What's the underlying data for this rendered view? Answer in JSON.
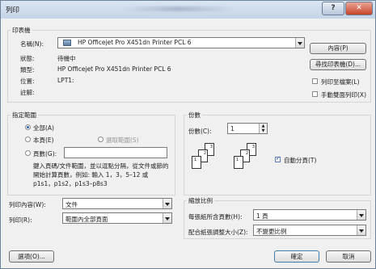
{
  "window": {
    "title": "列印",
    "help": "?",
    "close": "✕"
  },
  "printer": {
    "section_label": "印表機",
    "name_label": "名稱(N):",
    "name_value": "HP Officejet Pro X451dn Printer PCL 6",
    "status_label": "狀態:",
    "status_value": "待機中",
    "type_label": "類型:",
    "type_value": "HP Officejet Pro X451dn Printer PCL 6",
    "where_label": "位置:",
    "where_value": "LPT1:",
    "comment_label": "註解:",
    "properties_button": "內容(P)",
    "find_button": "尋找印表機(D)...",
    "print_to_file": "列印至檔案(L)",
    "manual_duplex": "手動雙面列印(X)"
  },
  "page_range": {
    "label": "指定範圍",
    "all": "全部(A)",
    "current": "本頁(E)",
    "selection": "選取範圍(S)",
    "pages": "頁數(G):",
    "pages_value": "",
    "hint": "鍵入頁碼/文件範圍，並以逗點分隔，從文件或節的開始計算頁數，例如: 輸入 1，3，5–12 或 p1s1，p1s2，p1s3–p8s3"
  },
  "copies": {
    "label": "份數",
    "count_label": "份數(C):",
    "count_value": "1",
    "collate": "自動分頁(T)",
    "collate_checked": true,
    "page_numbers": [
      "1",
      "2",
      "3",
      "1",
      "2",
      "3"
    ]
  },
  "print_what": {
    "label": "列印內容(W):",
    "value": "文件"
  },
  "print": {
    "label": "列印(R):",
    "value": "範圍內全部頁面"
  },
  "zoom": {
    "label": "縮放比例",
    "pages_per_sheet_label": "每張紙所含頁數(H):",
    "pages_per_sheet_value": "1 頁",
    "scale_label": "配合紙張調整大小(Z):",
    "scale_value": "不變更比例"
  },
  "footer": {
    "options": "選項(O)...",
    "ok": "確定",
    "cancel": "取消"
  }
}
